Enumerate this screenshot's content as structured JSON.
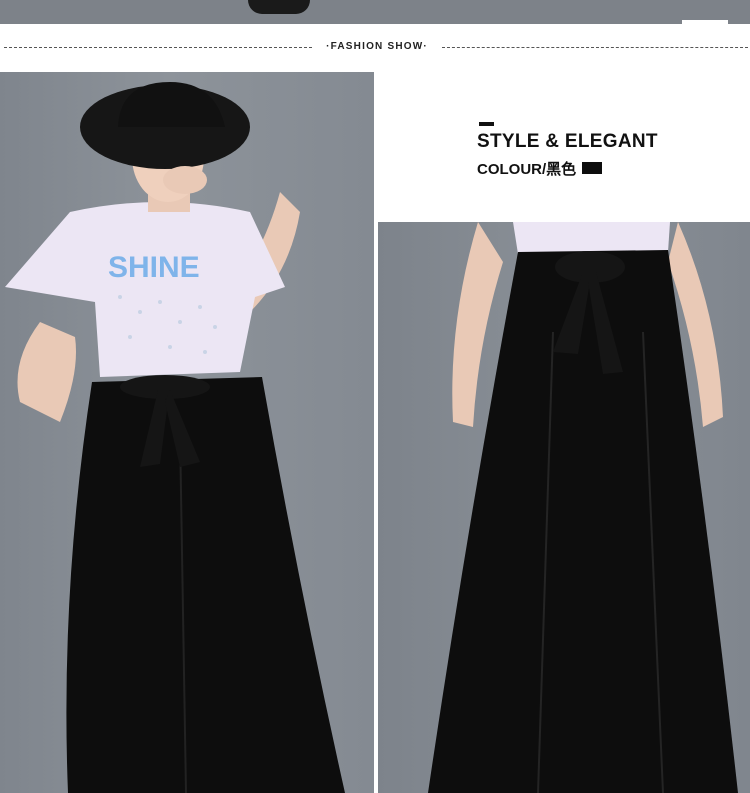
{
  "header": {
    "title": "·FASHION SHOW·"
  },
  "product": {
    "style_title": "STYLE & ELEGANT",
    "colour_label": "COLOUR/黑色",
    "colour_swatch": "#0d0d0d"
  },
  "tshirt_print": "SHINE",
  "colors": {
    "background": "#ffffff",
    "photo_backdrop": "#848a92",
    "pants": "#0d0d0d",
    "shirt": "#ece6f4"
  }
}
